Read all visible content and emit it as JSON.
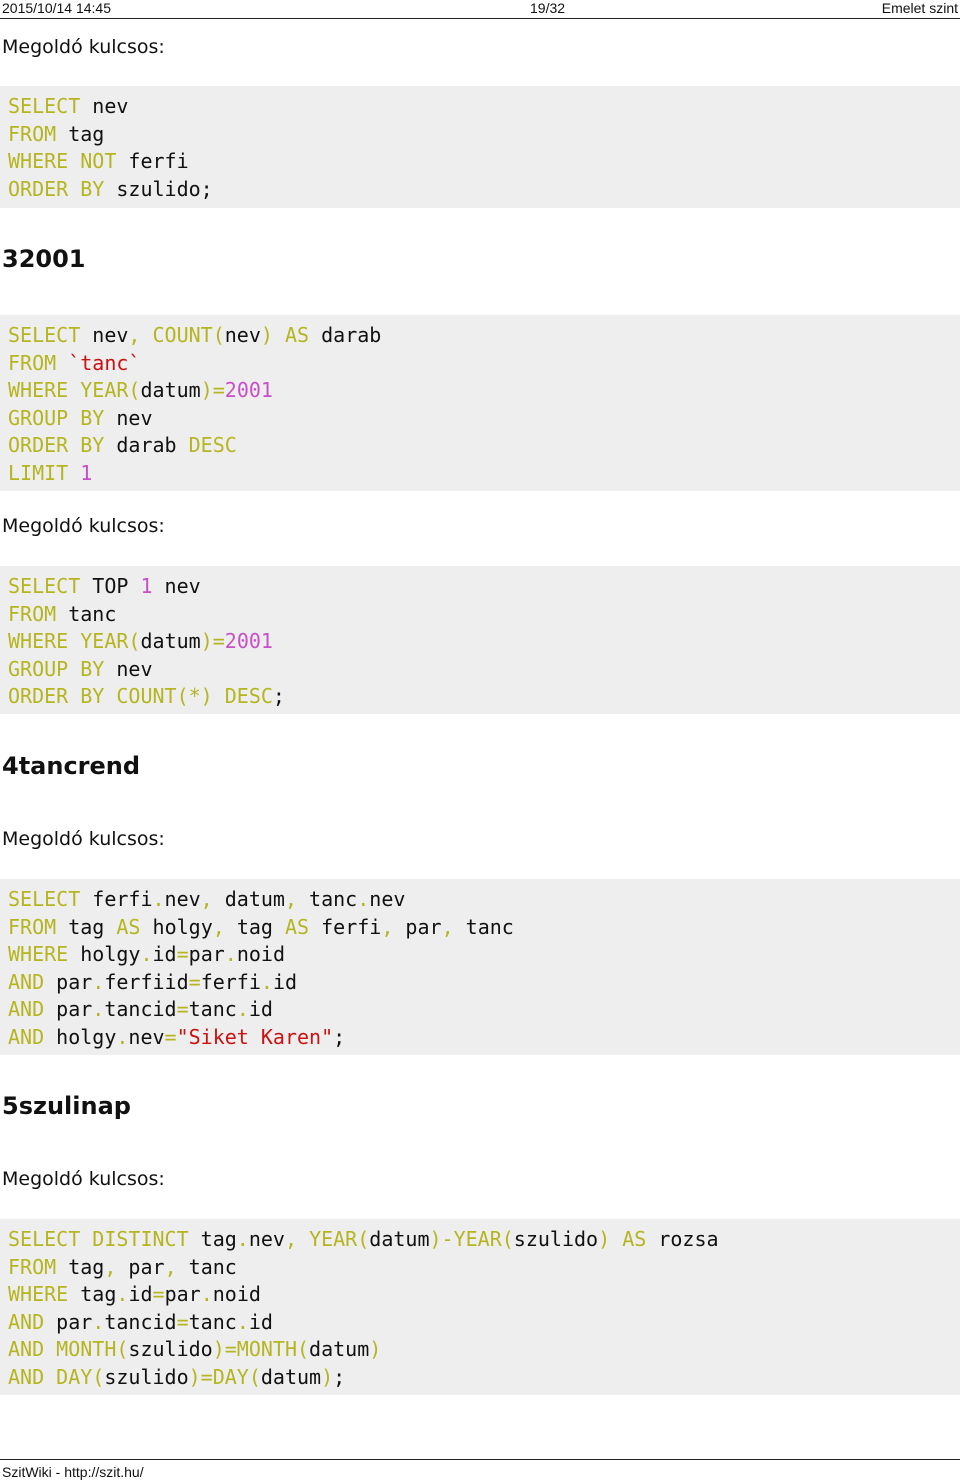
{
  "header": {
    "date": "2015/10/14 14:45",
    "page": "19/32",
    "title": "Emelet szint"
  },
  "labels": {
    "key1": "Megoldó kulcsos:",
    "key2": "Megoldó kulcsos:",
    "key3": "Megoldó kulcsos:",
    "key4": "Megoldó kulcsos:"
  },
  "headings": {
    "h1": "32001",
    "h2": "4tancrend",
    "h3": "5szulinap"
  },
  "code_blocks": [
    {
      "lines": [
        [
          [
            "k",
            "SELECT"
          ],
          [
            "p",
            " nev"
          ]
        ],
        [
          [
            "k",
            "FROM"
          ],
          [
            "p",
            " tag"
          ]
        ],
        [
          [
            "k",
            "WHERE"
          ],
          [
            "p",
            " "
          ],
          [
            "k",
            "NOT"
          ],
          [
            "p",
            " ferfi"
          ]
        ],
        [
          [
            "k",
            "ORDER BY"
          ],
          [
            "p",
            " szulido;"
          ]
        ]
      ]
    },
    {
      "lines": [
        [
          [
            "k",
            "SELECT"
          ],
          [
            "p",
            " nev"
          ],
          [
            "k",
            ","
          ],
          [
            "p",
            " "
          ],
          [
            "k",
            "COUNT("
          ],
          [
            "p",
            "nev"
          ],
          [
            "k",
            ")"
          ],
          [
            "p",
            " "
          ],
          [
            "k",
            "AS"
          ],
          [
            "p",
            " darab"
          ]
        ],
        [
          [
            "k",
            "FROM"
          ],
          [
            "p",
            " "
          ],
          [
            "s",
            "`tanc`"
          ]
        ],
        [
          [
            "k",
            "WHERE"
          ],
          [
            "p",
            " "
          ],
          [
            "k",
            "YEAR("
          ],
          [
            "p",
            "datum"
          ],
          [
            "k",
            ")="
          ],
          [
            "n",
            "2001"
          ]
        ],
        [
          [
            "k",
            "GROUP BY"
          ],
          [
            "p",
            " nev"
          ]
        ],
        [
          [
            "k",
            "ORDER BY"
          ],
          [
            "p",
            " darab "
          ],
          [
            "k",
            "DESC"
          ]
        ],
        [
          [
            "k",
            "LIMIT"
          ],
          [
            "p",
            " "
          ],
          [
            "n",
            "1"
          ]
        ]
      ]
    },
    {
      "lines": [
        [
          [
            "k",
            "SELECT"
          ],
          [
            "p",
            " TOP "
          ],
          [
            "n",
            "1"
          ],
          [
            "p",
            " nev"
          ]
        ],
        [
          [
            "k",
            "FROM"
          ],
          [
            "p",
            " tanc"
          ]
        ],
        [
          [
            "k",
            "WHERE"
          ],
          [
            "p",
            " "
          ],
          [
            "k",
            "YEAR("
          ],
          [
            "p",
            "datum"
          ],
          [
            "k",
            ")="
          ],
          [
            "n",
            "2001"
          ]
        ],
        [
          [
            "k",
            "GROUP BY"
          ],
          [
            "p",
            " nev"
          ]
        ],
        [
          [
            "k",
            "ORDER BY"
          ],
          [
            "p",
            " "
          ],
          [
            "k",
            "COUNT(*)"
          ],
          [
            "p",
            " "
          ],
          [
            "k",
            "DESC"
          ],
          [
            "p",
            ";"
          ]
        ]
      ]
    },
    {
      "lines": [
        [
          [
            "k",
            "SELECT"
          ],
          [
            "p",
            " ferfi"
          ],
          [
            "k",
            "."
          ],
          [
            "p",
            "nev"
          ],
          [
            "k",
            ","
          ],
          [
            "p",
            " datum"
          ],
          [
            "k",
            ","
          ],
          [
            "p",
            " tanc"
          ],
          [
            "k",
            "."
          ],
          [
            "p",
            "nev"
          ]
        ],
        [
          [
            "k",
            "FROM"
          ],
          [
            "p",
            " tag "
          ],
          [
            "k",
            "AS"
          ],
          [
            "p",
            " holgy"
          ],
          [
            "k",
            ","
          ],
          [
            "p",
            " tag "
          ],
          [
            "k",
            "AS"
          ],
          [
            "p",
            " ferfi"
          ],
          [
            "k",
            ","
          ],
          [
            "p",
            " par"
          ],
          [
            "k",
            ","
          ],
          [
            "p",
            " tanc"
          ]
        ],
        [
          [
            "k",
            "WHERE"
          ],
          [
            "p",
            " holgy"
          ],
          [
            "k",
            "."
          ],
          [
            "p",
            "id"
          ],
          [
            "k",
            "="
          ],
          [
            "p",
            "par"
          ],
          [
            "k",
            "."
          ],
          [
            "p",
            "noid"
          ]
        ],
        [
          [
            "k",
            "AND"
          ],
          [
            "p",
            " par"
          ],
          [
            "k",
            "."
          ],
          [
            "p",
            "ferfiid"
          ],
          [
            "k",
            "="
          ],
          [
            "p",
            "ferfi"
          ],
          [
            "k",
            "."
          ],
          [
            "p",
            "id"
          ]
        ],
        [
          [
            "k",
            "AND"
          ],
          [
            "p",
            " par"
          ],
          [
            "k",
            "."
          ],
          [
            "p",
            "tancid"
          ],
          [
            "k",
            "="
          ],
          [
            "p",
            "tanc"
          ],
          [
            "k",
            "."
          ],
          [
            "p",
            "id"
          ]
        ],
        [
          [
            "k",
            "AND"
          ],
          [
            "p",
            " holgy"
          ],
          [
            "k",
            "."
          ],
          [
            "p",
            "nev"
          ],
          [
            "k",
            "="
          ],
          [
            "s",
            "\"Siket Karen\""
          ],
          [
            "p",
            ";"
          ]
        ]
      ]
    },
    {
      "lines": [
        [
          [
            "k",
            "SELECT"
          ],
          [
            "p",
            " "
          ],
          [
            "k",
            "DISTINCT"
          ],
          [
            "p",
            " tag"
          ],
          [
            "k",
            "."
          ],
          [
            "p",
            "nev"
          ],
          [
            "k",
            ","
          ],
          [
            "p",
            " "
          ],
          [
            "k",
            "YEAR("
          ],
          [
            "p",
            "datum"
          ],
          [
            "k",
            ")-YEAR("
          ],
          [
            "p",
            "szulido"
          ],
          [
            "k",
            ")"
          ],
          [
            "p",
            " "
          ],
          [
            "k",
            "AS"
          ],
          [
            "p",
            " rozsa"
          ]
        ],
        [
          [
            "k",
            "FROM"
          ],
          [
            "p",
            " tag"
          ],
          [
            "k",
            ","
          ],
          [
            "p",
            " par"
          ],
          [
            "k",
            ","
          ],
          [
            "p",
            " tanc"
          ]
        ],
        [
          [
            "k",
            "WHERE"
          ],
          [
            "p",
            " tag"
          ],
          [
            "k",
            "."
          ],
          [
            "p",
            "id"
          ],
          [
            "k",
            "="
          ],
          [
            "p",
            "par"
          ],
          [
            "k",
            "."
          ],
          [
            "p",
            "noid"
          ]
        ],
        [
          [
            "k",
            "AND"
          ],
          [
            "p",
            " par"
          ],
          [
            "k",
            "."
          ],
          [
            "p",
            "tancid"
          ],
          [
            "k",
            "="
          ],
          [
            "p",
            "tanc"
          ],
          [
            "k",
            "."
          ],
          [
            "p",
            "id"
          ]
        ],
        [
          [
            "k",
            "AND"
          ],
          [
            "p",
            " "
          ],
          [
            "k",
            "MONTH("
          ],
          [
            "p",
            "szulido"
          ],
          [
            "k",
            ")=MONTH("
          ],
          [
            "p",
            "datum"
          ],
          [
            "k",
            ")"
          ]
        ],
        [
          [
            "k",
            "AND"
          ],
          [
            "p",
            " "
          ],
          [
            "k",
            "DAY("
          ],
          [
            "p",
            "szulido"
          ],
          [
            "k",
            ")=DAY("
          ],
          [
            "p",
            "datum"
          ],
          [
            "k",
            ")"
          ],
          [
            "p",
            ";"
          ]
        ]
      ]
    }
  ],
  "footer": {
    "text": "SzitWiki - http://szit.hu/"
  }
}
